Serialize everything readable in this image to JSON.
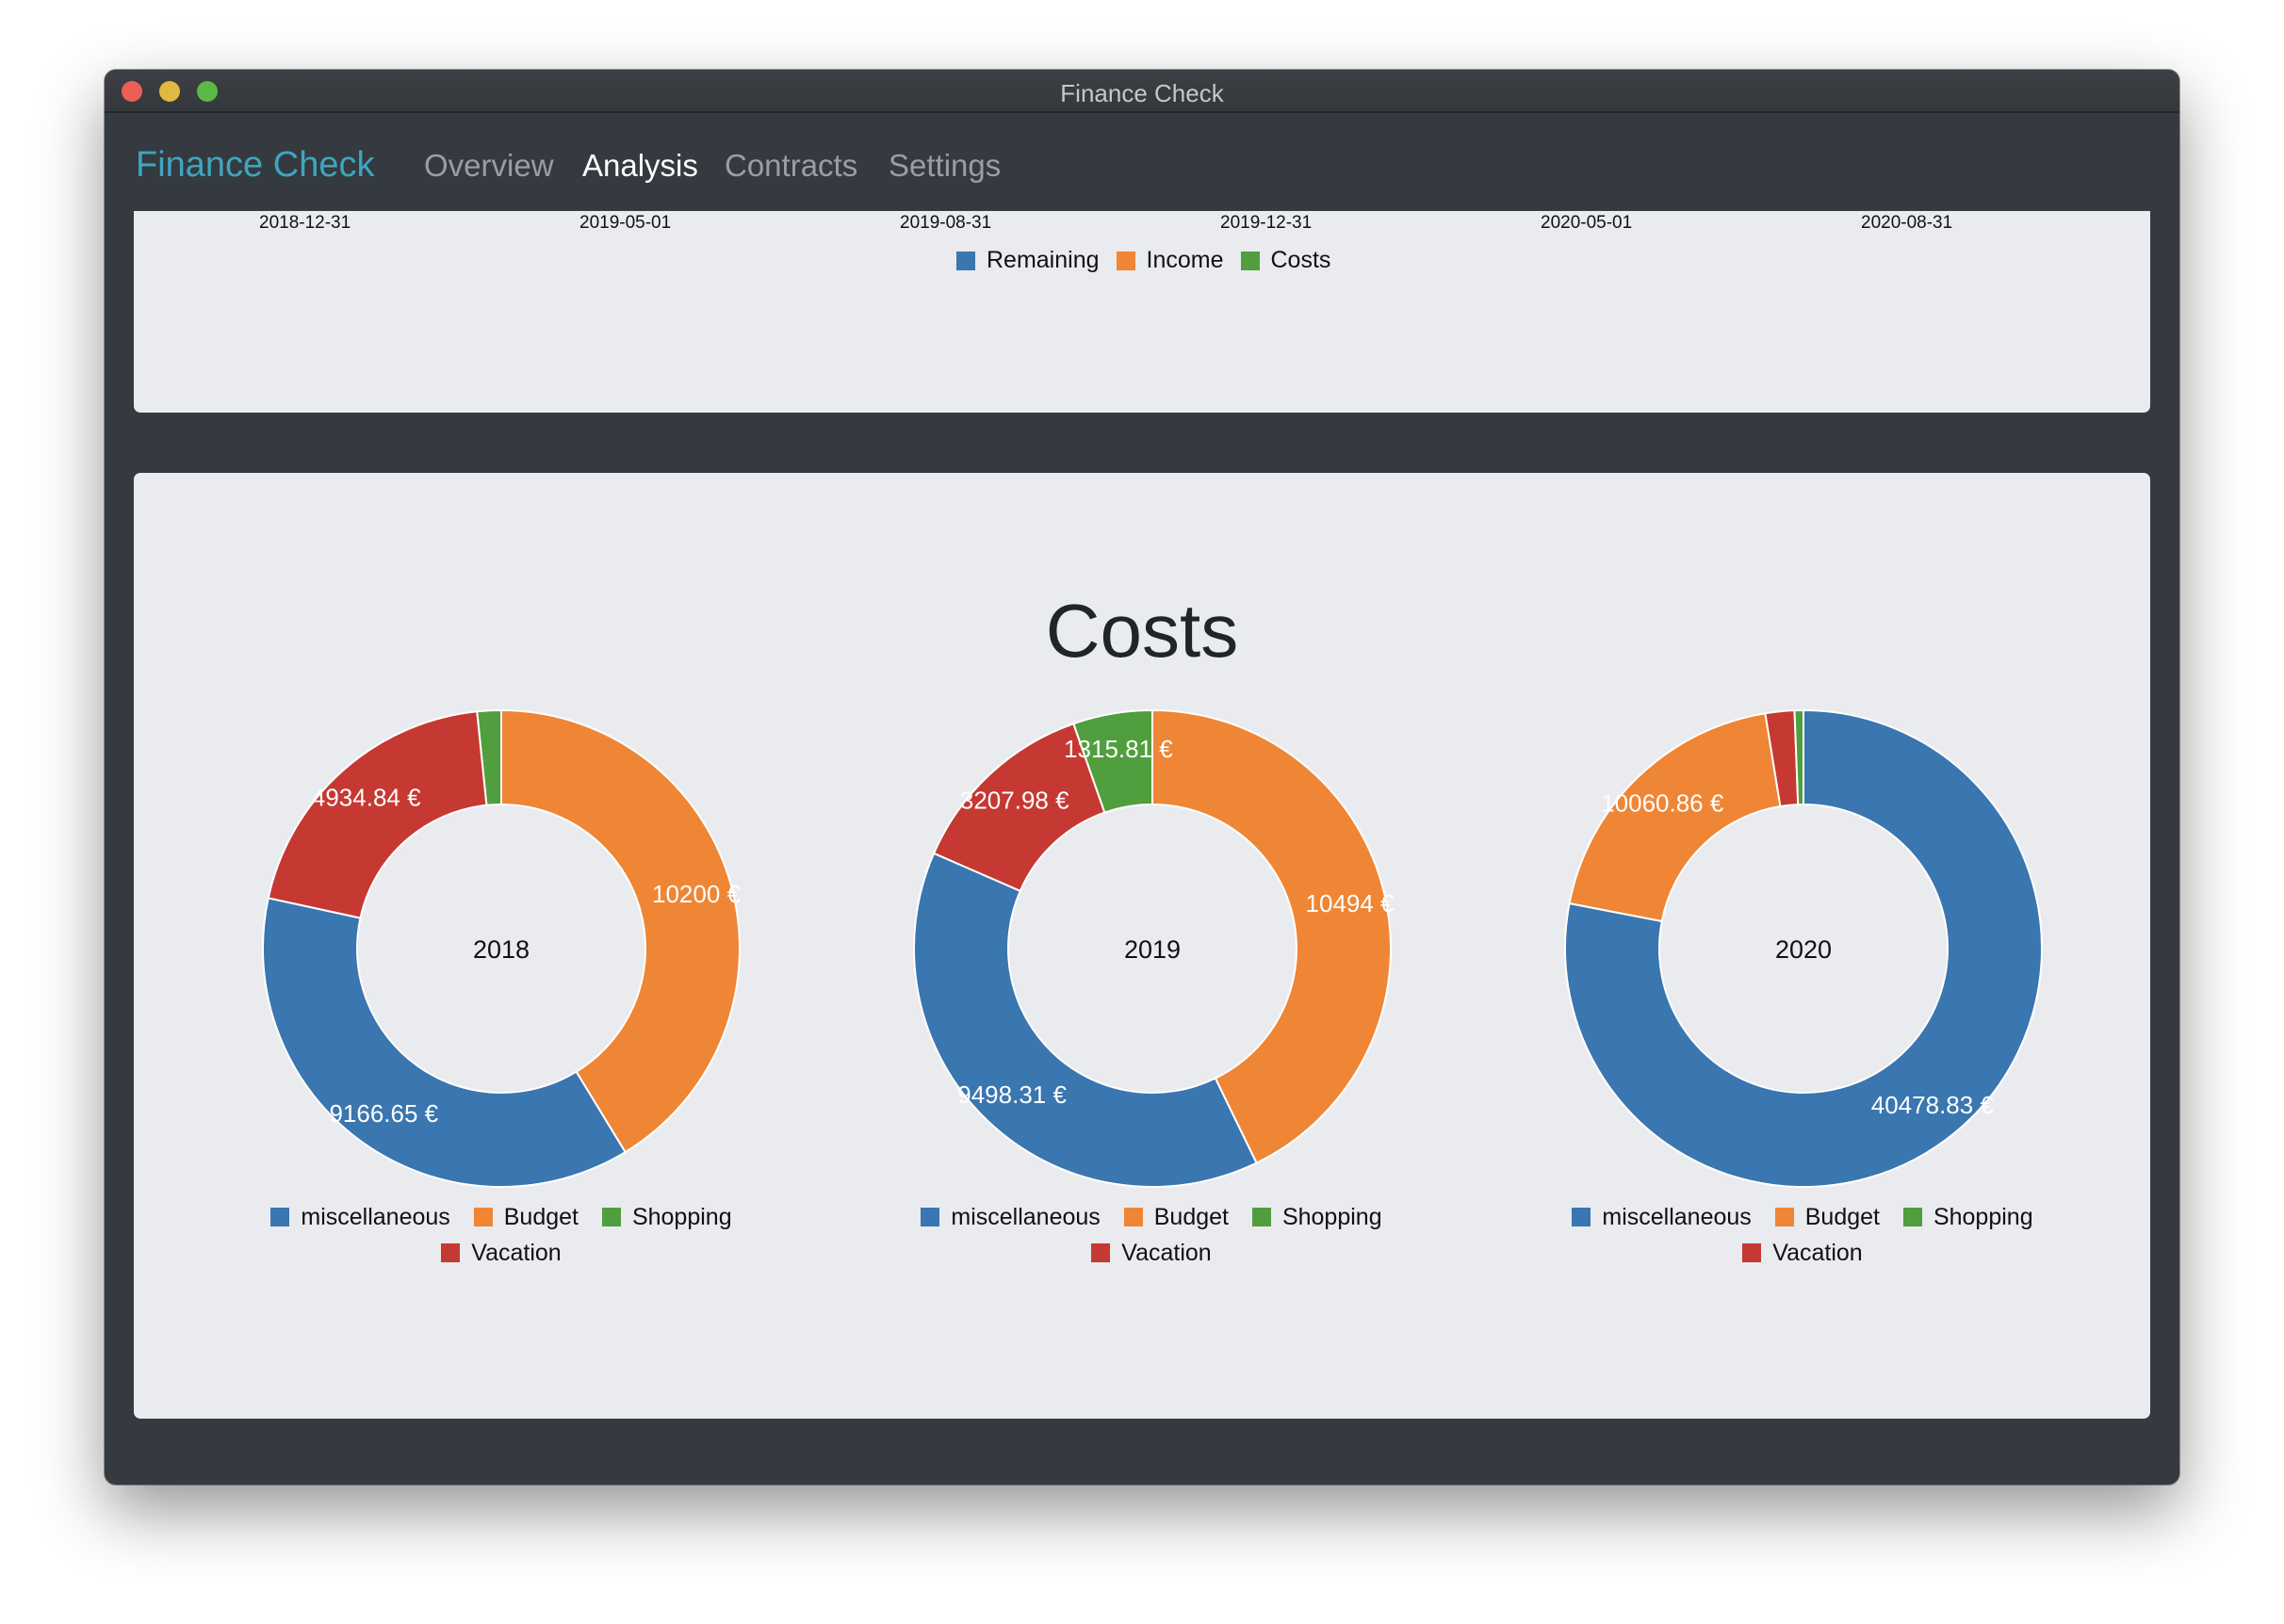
{
  "window": {
    "title": "Finance Check"
  },
  "nav": {
    "brand": "Finance Check",
    "items": [
      {
        "label": "Overview",
        "active": false
      },
      {
        "label": "Analysis",
        "active": true
      },
      {
        "label": "Contracts",
        "active": false
      },
      {
        "label": "Settings",
        "active": false
      }
    ]
  },
  "top_chart": {
    "x_labels": [
      "2018-12-31",
      "2019-05-01",
      "2019-08-31",
      "2019-12-31",
      "2020-05-01",
      "2020-08-31"
    ],
    "legend": [
      {
        "name": "Remaining",
        "color": "#3a76af"
      },
      {
        "name": "Income",
        "color": "#ef8636"
      },
      {
        "name": "Costs",
        "color": "#519e3e"
      }
    ]
  },
  "costs_title": "Costs",
  "colors": {
    "miscellaneous": "#3a76af",
    "Budget": "#ef8636",
    "Shopping": "#519e3e",
    "Vacation": "#c53932"
  },
  "chart_data": [
    {
      "type": "pie",
      "center_label": "2018",
      "categories": [
        "Budget",
        "miscellaneous",
        "Vacation",
        "Shopping"
      ],
      "values": [
        10200,
        9166.65,
        4934.84,
        400
      ],
      "data_labels": [
        "10200 €",
        "9166.65 €",
        "4934.84 €",
        ""
      ],
      "legend": [
        "miscellaneous",
        "Budget",
        "Shopping",
        "Vacation"
      ]
    },
    {
      "type": "pie",
      "center_label": "2019",
      "categories": [
        "Budget",
        "miscellaneous",
        "Vacation",
        "Shopping"
      ],
      "values": [
        10494,
        9498.31,
        3207.98,
        1315.81
      ],
      "data_labels": [
        "10494 €",
        "9498.31 €",
        "3207.98 €",
        "1315.81 €"
      ],
      "legend": [
        "miscellaneous",
        "Budget",
        "Shopping",
        "Vacation"
      ]
    },
    {
      "type": "pie",
      "center_label": "2020",
      "categories": [
        "miscellaneous",
        "Budget",
        "Vacation",
        "Shopping"
      ],
      "values": [
        40478.83,
        10060.86,
        1020,
        310
      ],
      "data_labels": [
        "40478.83 €",
        "10060.86 €",
        "",
        ""
      ],
      "legend": [
        "miscellaneous",
        "Budget",
        "Shopping",
        "Vacation"
      ]
    }
  ]
}
